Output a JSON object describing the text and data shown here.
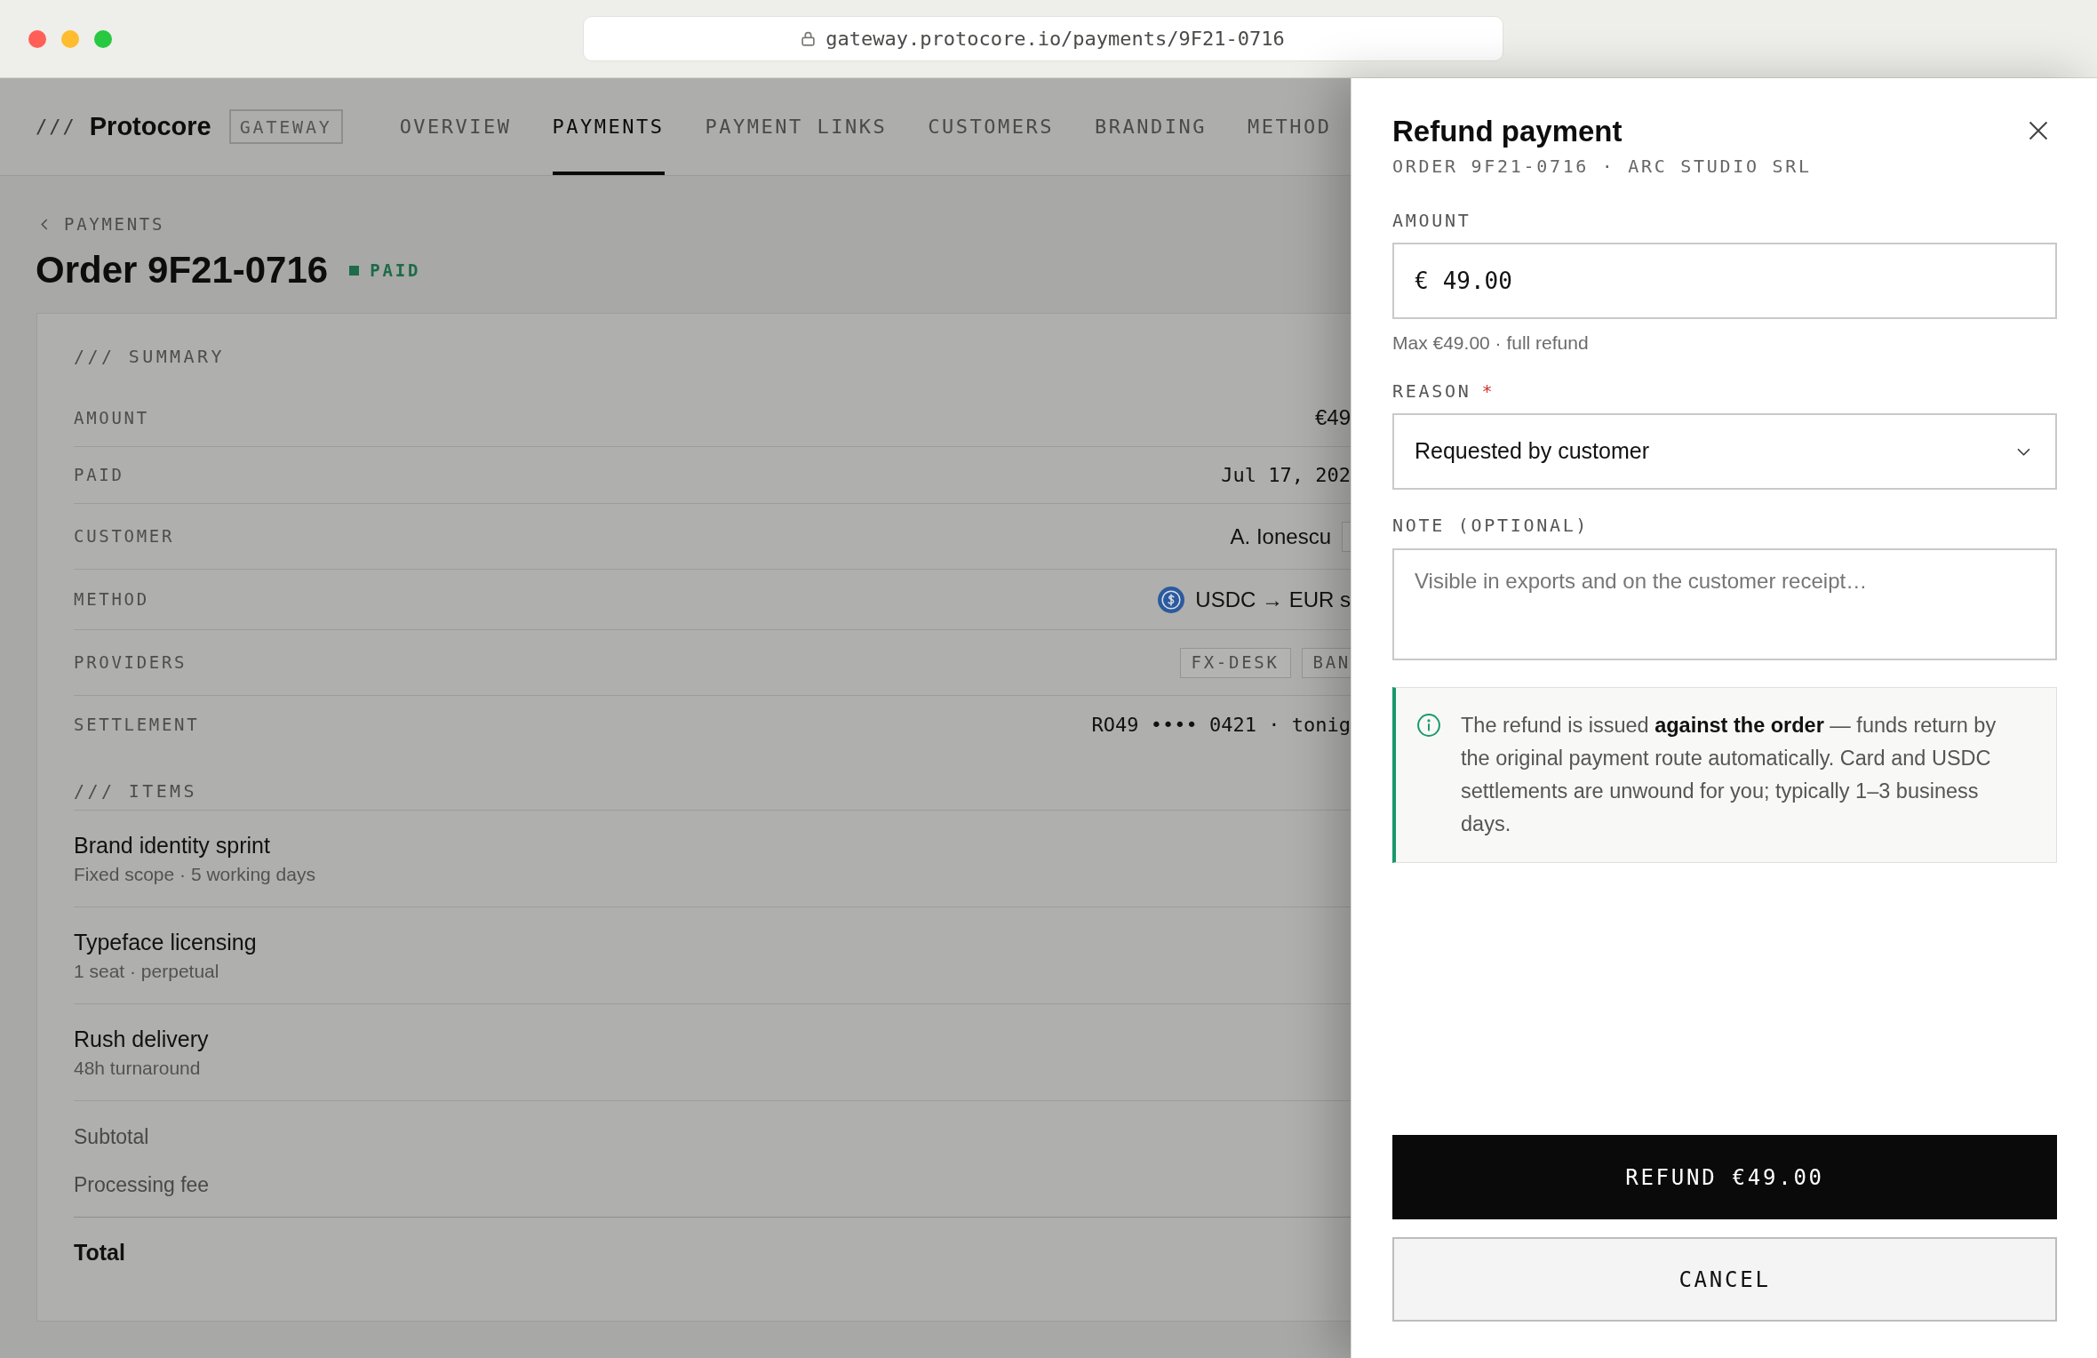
{
  "browser": {
    "url": "gateway.protocore.io/payments/9F21-0716"
  },
  "header": {
    "logo_mark": "///",
    "brand": "Protocore",
    "product_badge": "GATEWAY",
    "nav": [
      {
        "label": "OVERVIEW",
        "selected": false
      },
      {
        "label": "PAYMENTS",
        "selected": true
      },
      {
        "label": "PAYMENT LINKS",
        "selected": false
      },
      {
        "label": "CUSTOMERS",
        "selected": false
      },
      {
        "label": "BRANDING",
        "selected": false
      },
      {
        "label": "METHOD",
        "selected": false
      }
    ]
  },
  "page": {
    "breadcrumb": "PAYMENTS",
    "title": "Order 9F21-0716",
    "status": "PAID"
  },
  "summary": {
    "heading": "/// SUMMARY",
    "rows": [
      {
        "kind": "amount",
        "label": "AMOUNT",
        "value": "€49"
      },
      {
        "kind": "date",
        "label": "PAID",
        "value": "Jul 17, 202"
      },
      {
        "kind": "customer",
        "label": "CUSTOMER",
        "value": "A. Ionescu"
      },
      {
        "kind": "method",
        "label": "METHOD",
        "value": "USDC → EUR s"
      },
      {
        "kind": "tags",
        "label": "PROVIDERS",
        "tags": [
          "FX-DESK",
          "BAN"
        ]
      },
      {
        "kind": "account",
        "label": "SETTLEMENT",
        "value": "RO49 •••• 0421 · tonig"
      }
    ]
  },
  "items": {
    "heading": "/// ITEMS",
    "lines": [
      {
        "name": "Brand identity sprint",
        "detail": "Fixed scope · 5 working days"
      },
      {
        "name": "Typeface licensing",
        "detail": "1 seat · perpetual"
      },
      {
        "name": "Rush delivery",
        "detail": "48h turnaround"
      }
    ],
    "totals": [
      {
        "kind": "subtotal",
        "label": "Subtotal"
      },
      {
        "kind": "fee",
        "label": "Processing fee"
      },
      {
        "kind": "total",
        "label": "Total"
      }
    ]
  },
  "refund_panel": {
    "title": "Refund payment",
    "subtitle": "ORDER 9F21-0716 · ARC STUDIO SRL",
    "fields": [
      {
        "kind": "amount",
        "label": "AMOUNT",
        "currency": "€",
        "value": "49.00",
        "hint": "Max €49.00 · full refund"
      },
      {
        "kind": "select",
        "label": "REASON",
        "required_mark": "*",
        "value": "Requested by customer"
      },
      {
        "kind": "textarea",
        "label": "NOTE (OPTIONAL)",
        "placeholder": "Visible in exports and on the customer receipt…"
      }
    ],
    "notice": "The refund is issued **against the order** — funds return by the original payment route automatically. Card and USDC settlements are unwound for you; typically 1–3 business days.",
    "buttons": [
      {
        "kind": "primary",
        "label": "REFUND €49.00"
      },
      {
        "kind": "secondary",
        "label": "CANCEL"
      }
    ]
  }
}
